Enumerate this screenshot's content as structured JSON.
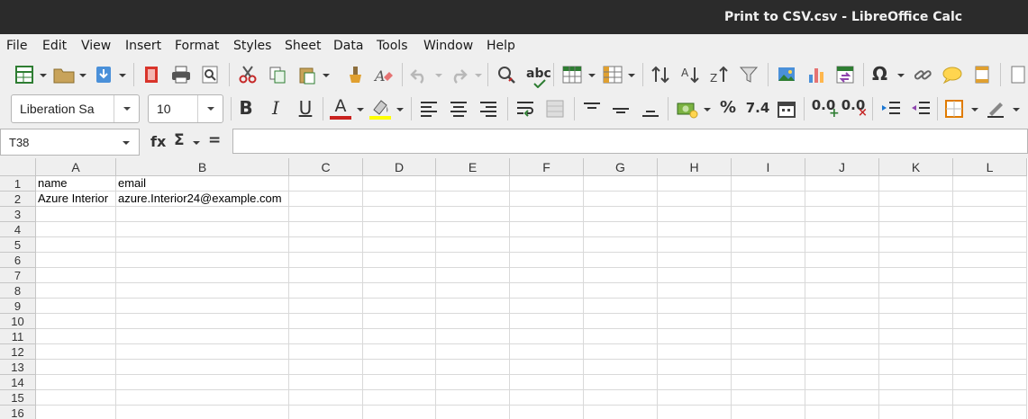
{
  "window": {
    "title": "Print to CSV.csv - LibreOffice Calc"
  },
  "menu": [
    "File",
    "Edit",
    "View",
    "Insert",
    "Format",
    "Styles",
    "Sheet",
    "Data",
    "Tools",
    "Window",
    "Help"
  ],
  "toolbar_standard": {
    "icons": [
      "new-icon",
      "open-icon",
      "save-icon",
      "export-pdf-icon",
      "print-icon",
      "print-preview-icon",
      "cut-icon",
      "copy-icon",
      "paste-icon",
      "clone-formatting-icon",
      "clear-formatting-icon",
      "undo-icon",
      "redo-icon",
      "find-replace-icon",
      "spelling-icon",
      "row-icon",
      "column-icon",
      "sort-icon",
      "sort-ascending-icon",
      "sort-descending-icon",
      "autofilter-icon",
      "insert-image-icon",
      "insert-chart-icon",
      "pivot-table-icon",
      "special-character-icon",
      "hyperlink-icon",
      "comment-icon",
      "header-footer-icon"
    ],
    "spelling_glyph": "abc",
    "special_char_glyph": "Ω"
  },
  "toolbar_format": {
    "font_name": "Liberation Sa",
    "font_size": "10",
    "bold_glyph": "B",
    "italic_glyph": "I",
    "underline_glyph": "U",
    "font_color_glyph": "A",
    "percent_glyph": "%",
    "number_glyph": "7.4",
    "add_decimal_glyph": "0.0",
    "del_decimal_glyph": "0.0",
    "font_color_bar": "#c9211e",
    "highlight_color_bar": "#ffff00"
  },
  "formula_bar": {
    "cell_reference": "T38",
    "fx_glyph": "fx",
    "sum_glyph": "Σ",
    "equals_glyph": "=",
    "formula": ""
  },
  "sheet": {
    "columns": [
      "A",
      "B",
      "C",
      "D",
      "E",
      "F",
      "G",
      "H",
      "I",
      "J",
      "K",
      "L"
    ],
    "rows": [
      "1",
      "2",
      "3",
      "4",
      "5",
      "6",
      "7",
      "8",
      "9",
      "10",
      "11",
      "12",
      "13",
      "14",
      "15",
      "16"
    ],
    "cells": [
      [
        "name",
        "email"
      ],
      [
        "Azure Interior",
        "azure.Interior24@example.com"
      ]
    ]
  }
}
